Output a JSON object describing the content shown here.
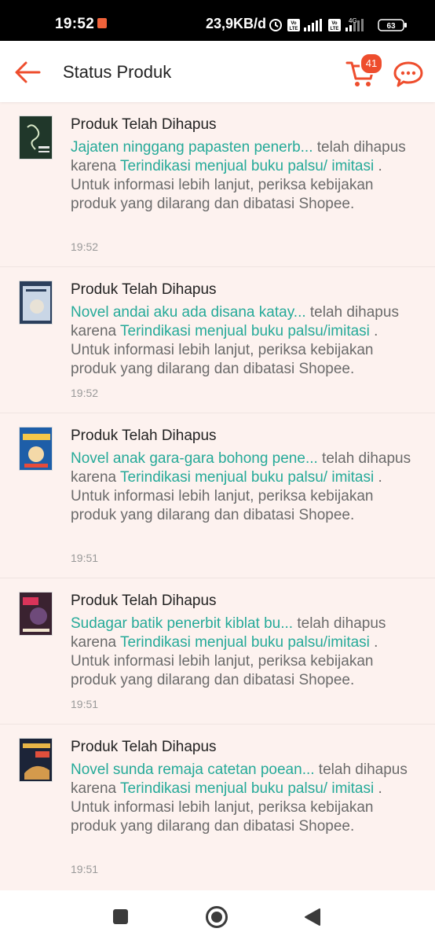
{
  "status_bar": {
    "time": "19:52",
    "network_speed": "23,9KB/d",
    "battery": "63",
    "network_type": "4G",
    "volte_label": "Vo LTE"
  },
  "header": {
    "title": "Status Produk",
    "cart_count": "41",
    "back_icon": "arrow-left-icon",
    "cart_icon": "cart-icon",
    "chat_icon": "chat-icon"
  },
  "notifications": [
    {
      "title": "Produk Telah Dihapus",
      "product": "Jajaten ninggang papasten penerb...",
      "mid_text": " telah dihapus karena ",
      "reason": "Terindikasi menjual buku palsu/ imitasi",
      "tail": " . Untuk informasi lebih lanjut, periksa kebijakan produk yang dilarang dan dibatasi Shopee.",
      "time": "19:52"
    },
    {
      "title": "Produk Telah Dihapus",
      "product": "Novel andai aku ada disana katay...",
      "mid_text": " telah dihapus karena ",
      "reason": "Terindikasi menjual buku palsu/imitasi",
      "tail": " . Untuk informasi lebih lanjut, periksa kebijakan produk yang dilarang dan dibatasi Shopee.",
      "time": "19:52"
    },
    {
      "title": "Produk Telah Dihapus",
      "product": "Novel anak gara-gara bohong pene...",
      "mid_text": " telah dihapus karena ",
      "reason": "Terindikasi menjual buku palsu/ imitasi",
      "tail": " . Untuk informasi lebih lanjut, periksa kebijakan produk yang dilarang dan dibatasi Shopee.",
      "time": "19:51"
    },
    {
      "title": "Produk Telah Dihapus",
      "product": "Sudagar batik penerbit kiblat bu...",
      "mid_text": " telah dihapus karena ",
      "reason": "Terindikasi menjual buku palsu/imitasi",
      "tail": " . Untuk informasi lebih lanjut, periksa kebijakan produk yang dilarang dan dibatasi Shopee.",
      "time": "19:51"
    },
    {
      "title": "Produk Telah Dihapus",
      "product": "Novel sunda remaja catetan poean...",
      "mid_text": " telah dihapus karena ",
      "reason": "Terindikasi menjual buku palsu/ imitasi",
      "tail": " . Untuk informasi lebih lanjut, periksa kebijakan produk yang dilarang dan dibatasi Shopee.",
      "time": "19:51"
    }
  ],
  "colors": {
    "accent": "#ee4d2d",
    "link": "#26aa99",
    "background": "#fdf2ef"
  },
  "nav": {
    "recents_icon": "square-icon",
    "home_icon": "home-circle-icon",
    "back_icon": "triangle-back-icon"
  }
}
